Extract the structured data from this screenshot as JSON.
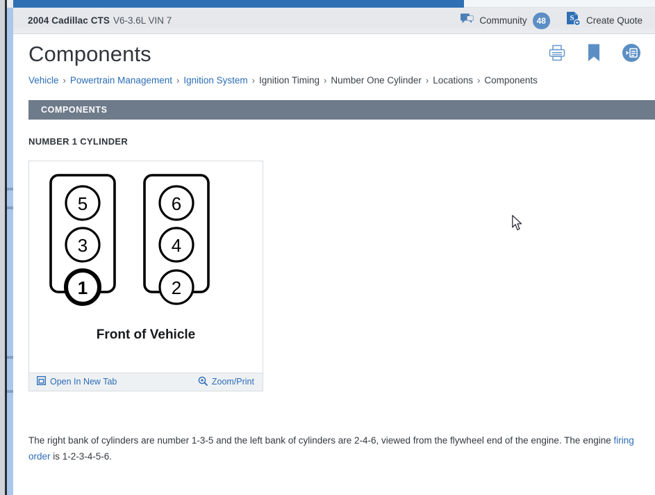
{
  "window": {
    "top_bar_color": "#2f70b5"
  },
  "vehicle_bar": {
    "vehicle": "2004 Cadillac CTS",
    "engine": "V6-3.6L VIN 7",
    "community_label": "Community",
    "community_count": "48",
    "community_icon": "chat-bubble-icon",
    "create_quote_label": "Create Quote",
    "create_quote_icon": "quote-document-icon",
    "badge_color": "#5b8ec4"
  },
  "header": {
    "title": "Components",
    "icons": [
      {
        "name": "print-icon",
        "label": "Print"
      },
      {
        "name": "bookmark-icon",
        "label": "Bookmark"
      },
      {
        "name": "list-options-icon",
        "label": "Table of Contents"
      }
    ]
  },
  "breadcrumb": {
    "separator": "›",
    "items": [
      {
        "label": "Vehicle",
        "link": true
      },
      {
        "label": "Powertrain Management",
        "link": true
      },
      {
        "label": "Ignition System",
        "link": true
      },
      {
        "label": "Ignition Timing",
        "link": false
      },
      {
        "label": "Number One Cylinder",
        "link": false
      },
      {
        "label": "Locations",
        "link": false
      },
      {
        "label": "Components",
        "link": false
      }
    ]
  },
  "section": {
    "banner_title": "COMPONENTS",
    "banner_color": "#6e7b8b",
    "sub_heading": "NUMBER 1 CYLINDER"
  },
  "figure": {
    "caption": "Front of Vehicle",
    "open_new_tab_label": "Open In New Tab",
    "open_new_tab_icon": "external-window-icon",
    "zoom_print_label": "Zoom/Print",
    "zoom_print_icon": "magnifier-plus-icon",
    "left_bank": [
      "5",
      "3",
      "1"
    ],
    "right_bank": [
      "6",
      "4",
      "2"
    ],
    "highlighted_cylinder": "1"
  },
  "body": {
    "paragraph_part1": "The right bank of cylinders are number 1-3-5 and the left bank of cylinders are 2-4-6, viewed from the flywheel end of the engine. The engine ",
    "paragraph_link": "firing order",
    "paragraph_part2": " is 1-2-3-4-5-6."
  }
}
